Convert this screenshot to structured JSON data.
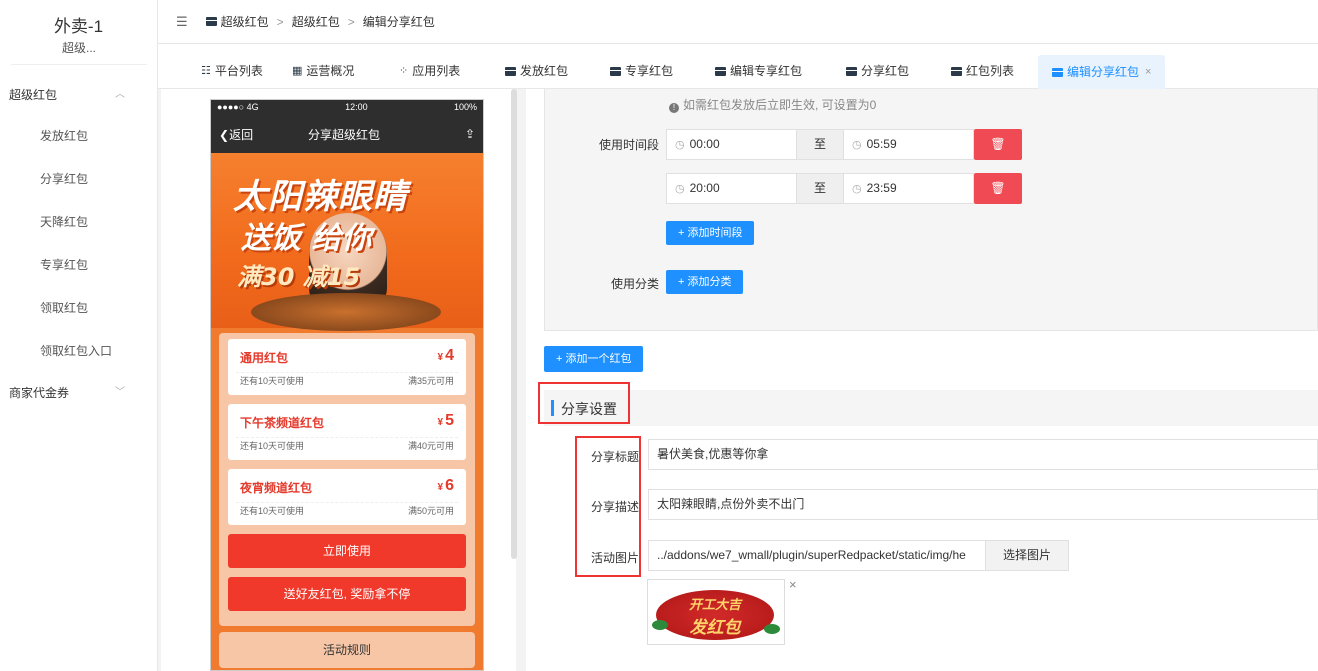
{
  "sidebar": {
    "title": "外卖-1",
    "subtitle": "超级...",
    "group1": "超级红包",
    "items": [
      {
        "label": "发放红包"
      },
      {
        "label": "分享红包"
      },
      {
        "label": "天降红包"
      },
      {
        "label": "专享红包"
      },
      {
        "label": "领取红包"
      },
      {
        "label": "领取红包入口"
      }
    ],
    "group2": "商家代金券"
  },
  "breadcrumb": {
    "items": [
      "超级红包",
      "超级红包",
      "编辑分享红包"
    ],
    "separator": ">"
  },
  "tabs": [
    {
      "label": "平台列表",
      "icon": "list-icon"
    },
    {
      "label": "运营概况",
      "icon": "dashboard-icon"
    },
    {
      "label": "应用列表",
      "icon": "apps-icon"
    },
    {
      "label": "发放红包",
      "icon": "envelope-icon"
    },
    {
      "label": "专享红包",
      "icon": "envelope-icon"
    },
    {
      "label": "编辑专享红包",
      "icon": "envelope-icon"
    },
    {
      "label": "分享红包",
      "icon": "envelope-icon"
    },
    {
      "label": "红包列表",
      "icon": "envelope-icon"
    },
    {
      "label": "编辑分享红包",
      "icon": "envelope-icon",
      "active": true,
      "close": "×"
    }
  ],
  "phone": {
    "signal": "●●●●○ 4G",
    "time": "12:00",
    "battery": "100%",
    "back": "返回",
    "title": "分享超级红包",
    "banner_line1": "太阳辣眼睛",
    "banner_line2": "送饭  给你",
    "banner_line3": "满30    减15",
    "coupons": [
      {
        "name": "通用红包",
        "currency": "¥",
        "value": "4",
        "left": "还有10天可使用",
        "right": "满35元可用"
      },
      {
        "name": "下午茶频道红包",
        "currency": "¥",
        "value": "5",
        "left": "还有10天可使用",
        "right": "满40元可用"
      },
      {
        "name": "夜宵频道红包",
        "currency": "¥",
        "value": "6",
        "left": "还有10天可使用",
        "right": "满50元可用"
      }
    ],
    "use_now": "立即使用",
    "share_friends": "送好友红包, 奖励拿不停",
    "rules": "活动规则"
  },
  "form": {
    "hint": "如需红包发放后立即生效, 可设置为0",
    "time_label": "使用时间段",
    "time_rows": [
      {
        "start": "00:00",
        "sep": "至",
        "end": "05:59"
      },
      {
        "start": "20:00",
        "sep": "至",
        "end": "23:59"
      }
    ],
    "add_time_btn": "+ 添加时间段",
    "category_label": "使用分类",
    "add_category_btn": "+ 添加分类",
    "add_redpacket_btn": "+ 添加一个红包",
    "share_section_title": "分享设置",
    "share_title_label": "分享标题",
    "share_title_value": "暑伏美食,优惠等你拿",
    "share_desc_label": "分享描述",
    "share_desc_value": "太阳辣眼睛,点份外卖不出门",
    "image_label": "活动图片",
    "image_path": "../addons/we7_wmall/plugin/superRedpacket/static/img/he",
    "choose_image_btn": "选择图片",
    "thumb_line1": "开工大吉",
    "thumb_line2": "发红包",
    "thumb_close": "×"
  },
  "colors": {
    "primary": "#1e90ff",
    "danger": "#f04b55",
    "highlight_box": "#ee3333"
  }
}
